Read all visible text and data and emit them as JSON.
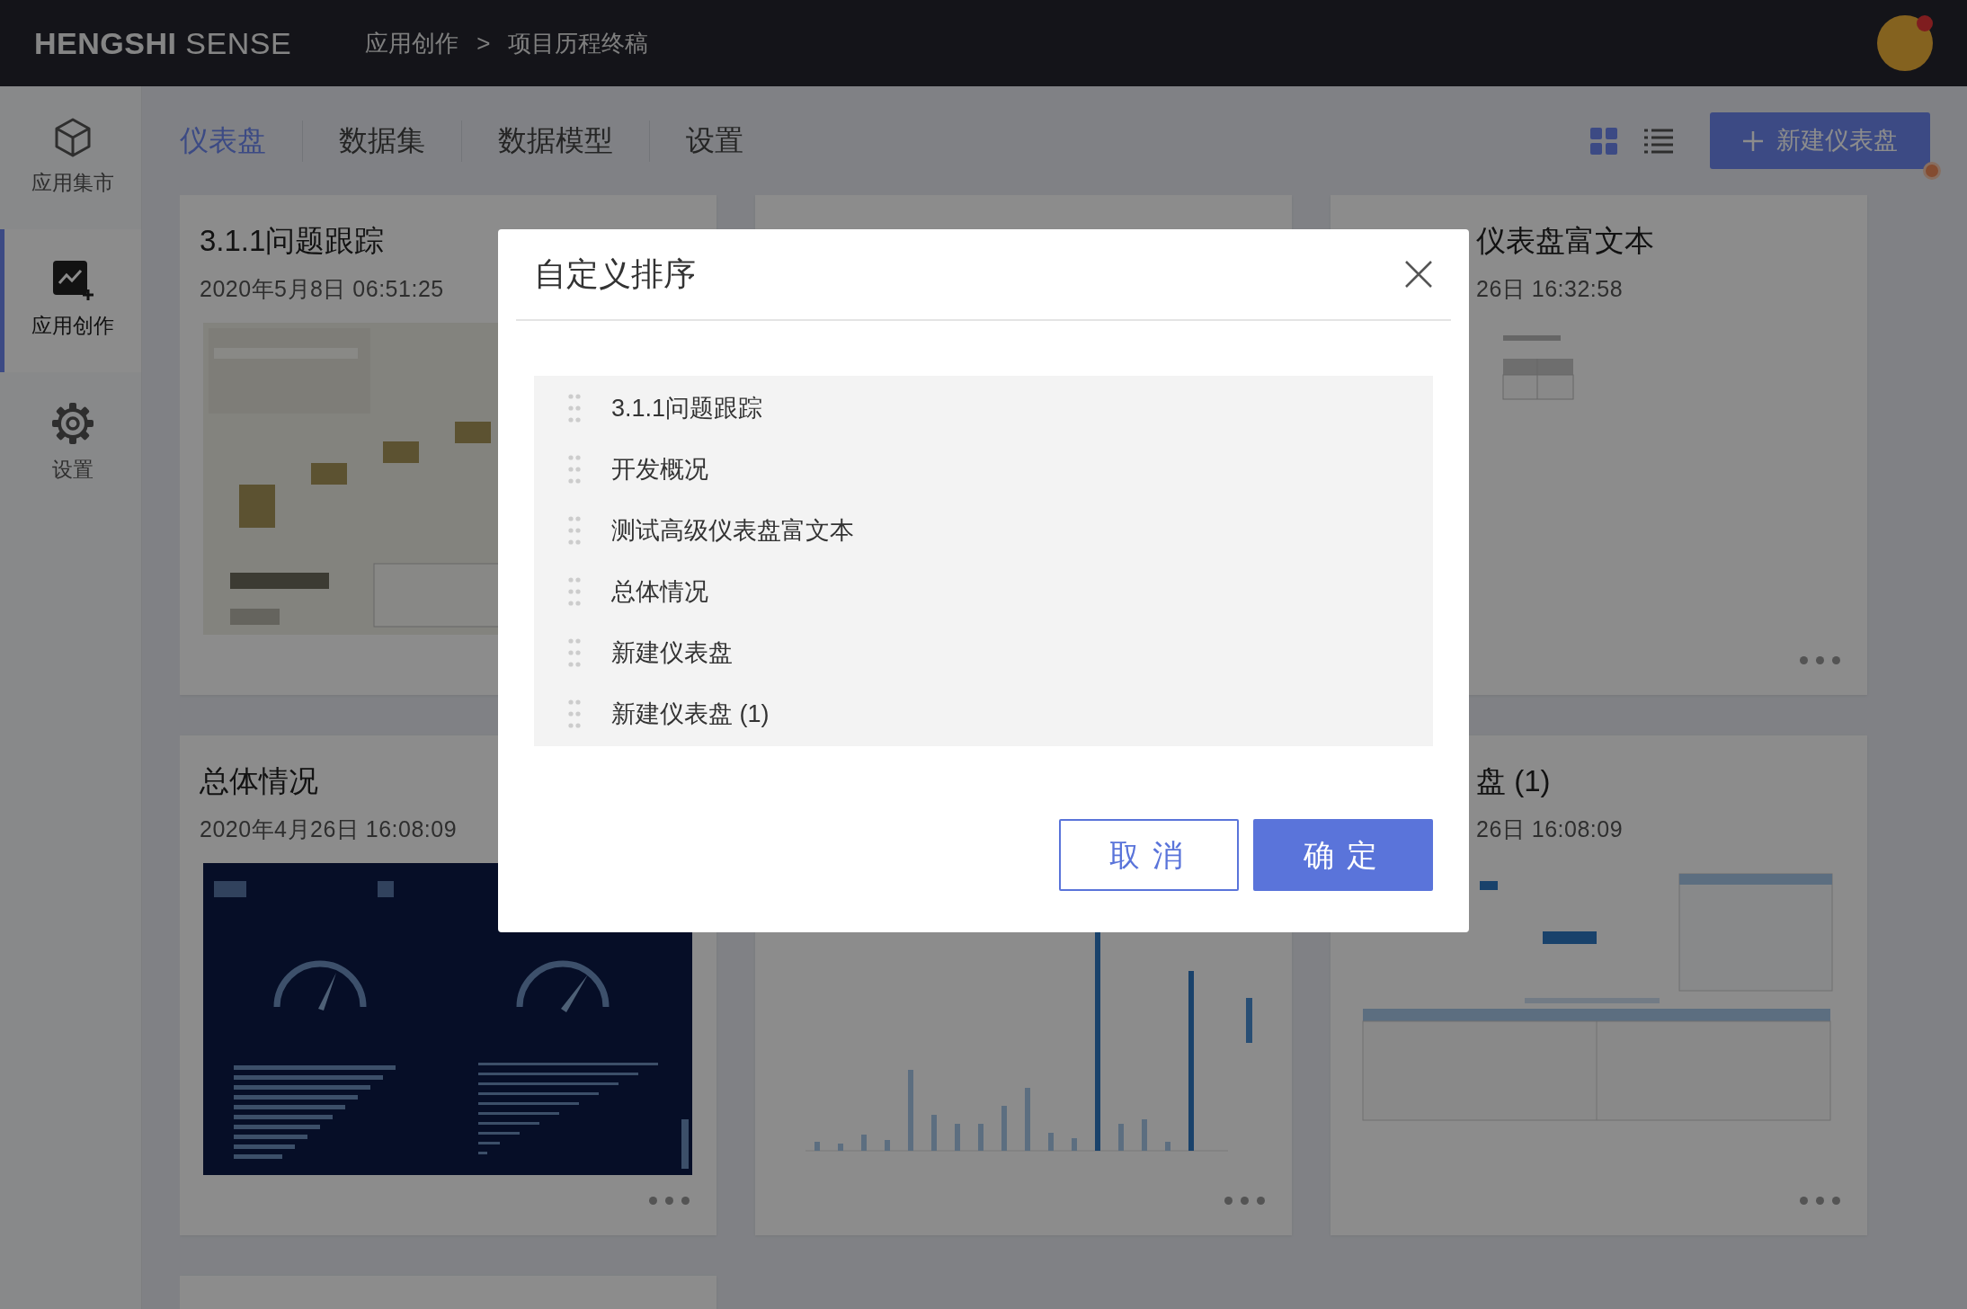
{
  "topbar": {
    "logo_bold": "HENGSHI",
    "logo_light": "SENSE",
    "breadcrumb": [
      "应用创作",
      "项目历程终稿"
    ],
    "separator": ">"
  },
  "sidebar": {
    "items": [
      {
        "label": "应用集市",
        "kind": "market",
        "selected": false
      },
      {
        "label": "应用创作",
        "kind": "create",
        "selected": true
      },
      {
        "label": "设置",
        "kind": "settings",
        "selected": false
      }
    ]
  },
  "tabs": [
    {
      "label": "仪表盘",
      "selected": true
    },
    {
      "label": "数据集",
      "selected": false
    },
    {
      "label": "数据模型",
      "selected": false
    },
    {
      "label": "设置",
      "selected": false
    }
  ],
  "toolbar": {
    "views": [
      {
        "kind": "grid",
        "selected": true
      },
      {
        "kind": "list",
        "selected": false
      }
    ],
    "new_button": {
      "label": "新建仪表盘"
    }
  },
  "cards": [
    {
      "kind": "dashboard",
      "title": "3.1.1问题跟踪",
      "date": "2020年5月8日 06:51:25"
    },
    {
      "kind": "dashboard"
    },
    {
      "kind": "dashboard",
      "title": "仪表盘富文本",
      "date": "26日 16:32:58"
    },
    {
      "kind": "dashboard",
      "title": "总体情况",
      "date": "2020年4月26日 16:08:09"
    },
    {
      "kind": "dashboard"
    },
    {
      "kind": "dashboard",
      "title": "盘 (1)",
      "date": "26日 16:08:09"
    },
    {
      "kind": "dashboard"
    }
  ],
  "dialog": {
    "title": "自定义排序",
    "items": [
      "3.1.1问题跟踪",
      "开发概况",
      "测试高级仪表盘富文本",
      "总体情况",
      "新建仪表盘",
      "新建仪表盘 (1)"
    ],
    "buttons": [
      {
        "label": "取消",
        "kind": "secondary"
      },
      {
        "label": "确定",
        "kind": "primary"
      }
    ]
  }
}
